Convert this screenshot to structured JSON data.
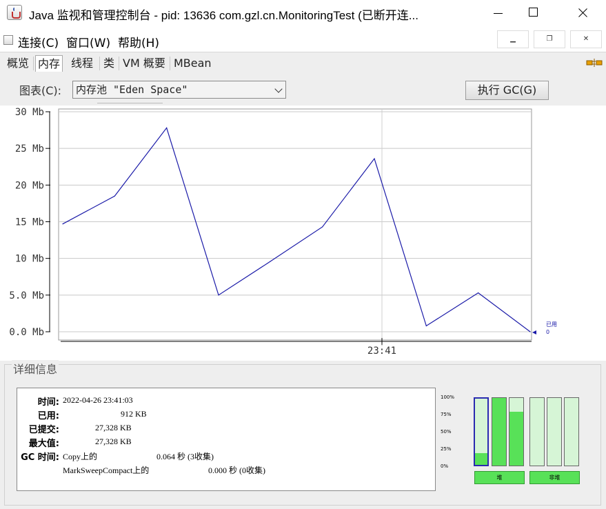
{
  "window": {
    "title": "Java 监视和管理控制台 - pid: 13636 com.gzl.cn.MonitoringTest (已断开连..."
  },
  "menu": {
    "items": [
      "连接(C)",
      "窗口(W)",
      "帮助(H)"
    ]
  },
  "tabs": [
    "概览",
    "内存",
    "线程",
    "类",
    "VM 概要",
    "MBean"
  ],
  "active_tab": "内存",
  "chart_selector": {
    "label": "图表(C):",
    "selected": "内存池 \"Eden Space\""
  },
  "gc_button": "执行 GC(G)",
  "chart_data": {
    "type": "line",
    "y_ticks": [
      "30 Mb",
      "25 Mb",
      "20 Mb",
      "15 Mb",
      "10 Mb",
      "5.0 Mb",
      "0.0 Mb"
    ],
    "ylim": [
      0,
      30
    ],
    "x_tick": "23:41",
    "series": [
      {
        "name": "已用",
        "color": "#1a1aa8",
        "values": [
          14.7,
          18.5,
          27.8,
          5.0,
          9.6,
          14.3,
          23.6,
          0.8,
          5.3,
          0.0
        ]
      }
    ],
    "legend_value": "0"
  },
  "details": {
    "title": "详细信息",
    "rows": [
      {
        "label": "时间:",
        "value": "2022-04-26 23:41:03"
      },
      {
        "label": "已用:",
        "value": "912 KB"
      },
      {
        "label": "已提交:",
        "value": "27,328 KB"
      },
      {
        "label": "最大值:",
        "value": "27,328 KB"
      }
    ],
    "gc": {
      "label": "GC 时间:",
      "entries": [
        {
          "name": "Copy上的",
          "time": "0.064 秒 (3收集)"
        },
        {
          "name": "MarkSweepCompact上的",
          "time": "0.000 秒 (0收集)"
        }
      ]
    }
  },
  "pool_bars": {
    "percent_labels": [
      "100%",
      "75%",
      "50%",
      "25%",
      "0%"
    ],
    "heap_label": "堆",
    "nonheap_label": "非堆",
    "heap_fill": [
      0.18,
      1.0,
      0.8
    ],
    "nonheap_fill": [
      0.0,
      0.0,
      0.0
    ]
  }
}
